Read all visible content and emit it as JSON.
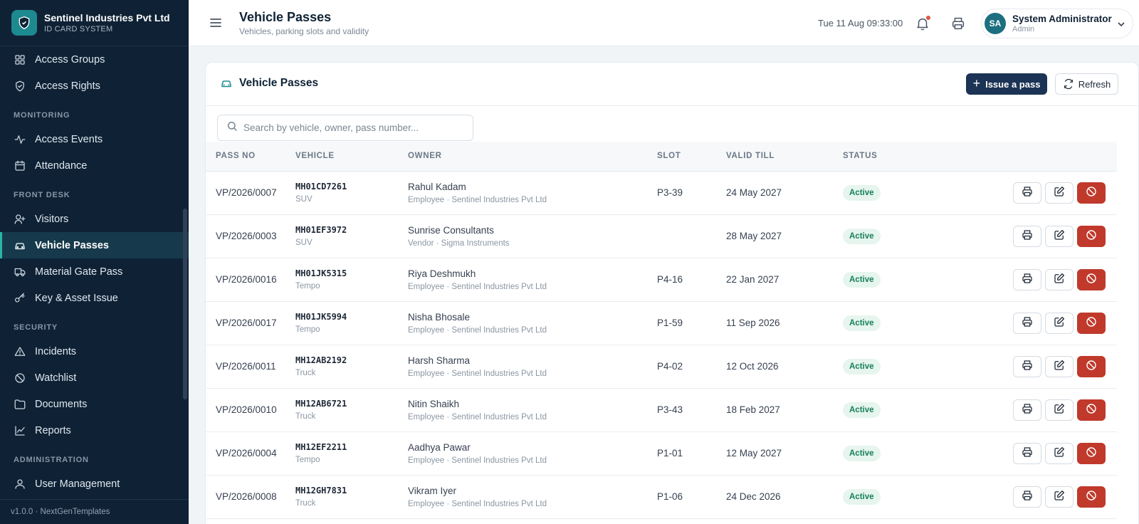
{
  "brand": {
    "name": "Sentinel Industries Pvt Ltd",
    "subtitle": "ID CARD SYSTEM"
  },
  "sidebar": {
    "items": [
      {
        "label": "Access Groups",
        "icon": "grid-icon"
      },
      {
        "label": "Access Rights",
        "icon": "shield-check-icon"
      },
      {
        "section": "MONITORING"
      },
      {
        "label": "Access Events",
        "icon": "activity-icon"
      },
      {
        "label": "Attendance",
        "icon": "calendar-icon"
      },
      {
        "section": "FRONT DESK"
      },
      {
        "label": "Visitors",
        "icon": "user-plus-icon"
      },
      {
        "label": "Vehicle Passes",
        "icon": "car-icon",
        "active": true
      },
      {
        "label": "Material Gate Pass",
        "icon": "truck-icon"
      },
      {
        "label": "Key & Asset Issue",
        "icon": "key-icon"
      },
      {
        "section": "SECURITY"
      },
      {
        "label": "Incidents",
        "icon": "alert-triangle-icon"
      },
      {
        "label": "Watchlist",
        "icon": "ban-icon"
      },
      {
        "label": "Documents",
        "icon": "folder-icon"
      },
      {
        "label": "Reports",
        "icon": "chart-line-icon"
      },
      {
        "section": "ADMINISTRATION"
      },
      {
        "label": "User Management",
        "icon": "user-icon"
      }
    ],
    "footer": "v1.0.0 · NextGenTemplates"
  },
  "topbar": {
    "title": "Vehicle Passes",
    "subtitle": "Vehicles, parking slots and validity",
    "datetime": "Tue 11 Aug 09:33:00",
    "user": {
      "initials": "SA",
      "name": "System Administrator",
      "role": "Admin"
    }
  },
  "card": {
    "title": "Vehicle Passes",
    "issue_label": "Issue a pass",
    "refresh_label": "Refresh",
    "search_placeholder": "Search by vehicle, owner, pass number..."
  },
  "table": {
    "columns": [
      "PASS NO",
      "VEHICLE",
      "OWNER",
      "SLOT",
      "VALID TILL",
      "STATUS"
    ],
    "rows": [
      {
        "pass": "VP/2026/0007",
        "vehicle": "MH01CD7261",
        "type": "SUV",
        "owner": "Rahul Kadam",
        "owner_sub": "Employee · Sentinel Industries Pvt Ltd",
        "slot": "P3-39",
        "valid": "24 May 2027",
        "status": "Active"
      },
      {
        "pass": "VP/2026/0003",
        "vehicle": "MH01EF3972",
        "type": "SUV",
        "owner": "Sunrise Consultants",
        "owner_sub": "Vendor · Sigma Instruments",
        "slot": "",
        "valid": "28 May 2027",
        "status": "Active"
      },
      {
        "pass": "VP/2026/0016",
        "vehicle": "MH01JK5315",
        "type": "Tempo",
        "owner": "Riya Deshmukh",
        "owner_sub": "Employee · Sentinel Industries Pvt Ltd",
        "slot": "P4-16",
        "valid": "22 Jan 2027",
        "status": "Active"
      },
      {
        "pass": "VP/2026/0017",
        "vehicle": "MH01JK5994",
        "type": "Tempo",
        "owner": "Nisha Bhosale",
        "owner_sub": "Employee · Sentinel Industries Pvt Ltd",
        "slot": "P1-59",
        "valid": "11 Sep 2026",
        "status": "Active"
      },
      {
        "pass": "VP/2026/0011",
        "vehicle": "MH12AB2192",
        "type": "Truck",
        "owner": "Harsh Sharma",
        "owner_sub": "Employee · Sentinel Industries Pvt Ltd",
        "slot": "P4-02",
        "valid": "12 Oct 2026",
        "status": "Active"
      },
      {
        "pass": "VP/2026/0010",
        "vehicle": "MH12AB6721",
        "type": "Truck",
        "owner": "Nitin Shaikh",
        "owner_sub": "Employee · Sentinel Industries Pvt Ltd",
        "slot": "P3-43",
        "valid": "18 Feb 2027",
        "status": "Active"
      },
      {
        "pass": "VP/2026/0004",
        "vehicle": "MH12EF2211",
        "type": "Tempo",
        "owner": "Aadhya Pawar",
        "owner_sub": "Employee · Sentinel Industries Pvt Ltd",
        "slot": "P1-01",
        "valid": "12 May 2027",
        "status": "Active"
      },
      {
        "pass": "VP/2026/0008",
        "vehicle": "MH12GH7831",
        "type": "Truck",
        "owner": "Vikram Iyer",
        "owner_sub": "Employee · Sentinel Industries Pvt Ltd",
        "slot": "P1-06",
        "valid": "24 Dec 2026",
        "status": "Active"
      }
    ]
  },
  "colors": {
    "sidebar_bg": "#0f2235",
    "accent": "#1d8a8f",
    "primary_button": "#1b3354",
    "danger": "#c0392b",
    "status_active": "#17805a"
  }
}
